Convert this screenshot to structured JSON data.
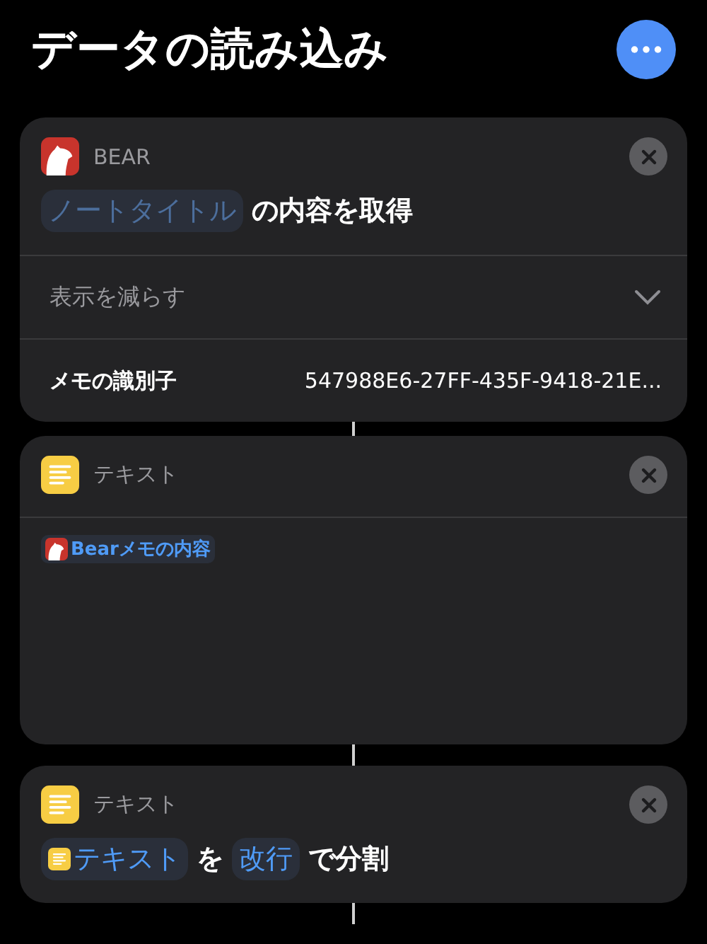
{
  "title": "データの読み込み",
  "actions": [
    {
      "kind": "bear",
      "app": "BEAR",
      "phrase": [
        {
          "kind": "placeholder",
          "text": "ノートタイトル"
        },
        {
          "kind": "text",
          "text": "の内容を取得"
        }
      ],
      "disclosure": {
        "label": "表示を減らす",
        "expanded": true
      },
      "params": [
        {
          "label": "メモの識別子",
          "value": "547988E6-27FF-435F-9418-21E..."
        }
      ]
    },
    {
      "kind": "text",
      "app": "テキスト",
      "body": [
        {
          "kind": "bear_variable",
          "text": "Bearメモの内容"
        }
      ]
    },
    {
      "kind": "text",
      "app": "テキスト",
      "phrase": [
        {
          "kind": "text_variable",
          "text": "テキスト"
        },
        {
          "kind": "text",
          "text": "を"
        },
        {
          "kind": "token",
          "text": "改行"
        },
        {
          "kind": "text",
          "text": "で分割"
        }
      ]
    }
  ]
}
